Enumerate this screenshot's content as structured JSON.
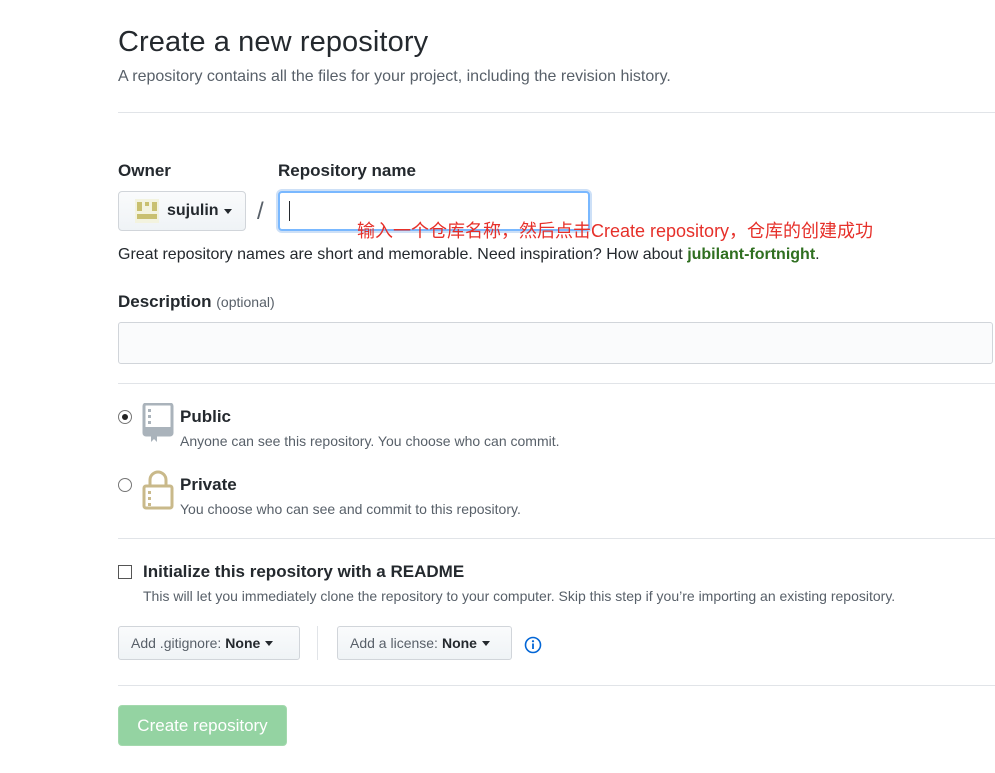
{
  "header": {
    "title": "Create a new repository",
    "subtitle": "A repository contains all the files for your project, including the revision history."
  },
  "owner": {
    "label": "Owner",
    "name": "sujulin"
  },
  "repo": {
    "label": "Repository name",
    "value": "",
    "separator": "/"
  },
  "annotation": "输入一个仓库名称，然后点击Create repository，仓库的创建成功",
  "hint": {
    "prefix": "Great repository names are short and memorable. Need inspiration? How about ",
    "suggestion": "jubilant-fortnight",
    "suffix": "."
  },
  "description": {
    "label": "Description",
    "optional": "(optional)",
    "value": ""
  },
  "visibility": {
    "selected": "public",
    "public": {
      "title": "Public",
      "note": "Anyone can see this repository. You choose who can commit."
    },
    "private": {
      "title": "Private",
      "note": "You choose who can see and commit to this repository."
    }
  },
  "init": {
    "label": "Initialize this repository with a README",
    "note": "This will let you immediately clone the repository to your computer. Skip this step if you’re importing an existing repository.",
    "checked": false
  },
  "gitignore": {
    "label": "Add .gitignore:",
    "value": "None"
  },
  "license": {
    "label": "Add a license:",
    "value": "None"
  },
  "create_button": "Create repository",
  "colors": {
    "annotation": "#e6302a",
    "suggestion": "#2f6f20",
    "create_button": "#94d3a2",
    "info": "#0366d6"
  },
  "icons": {
    "owner_avatar": "identicon-avatar",
    "public": "repo-book-icon",
    "private": "lock-icon",
    "info": "info-icon",
    "caret": "caret-down-icon"
  }
}
